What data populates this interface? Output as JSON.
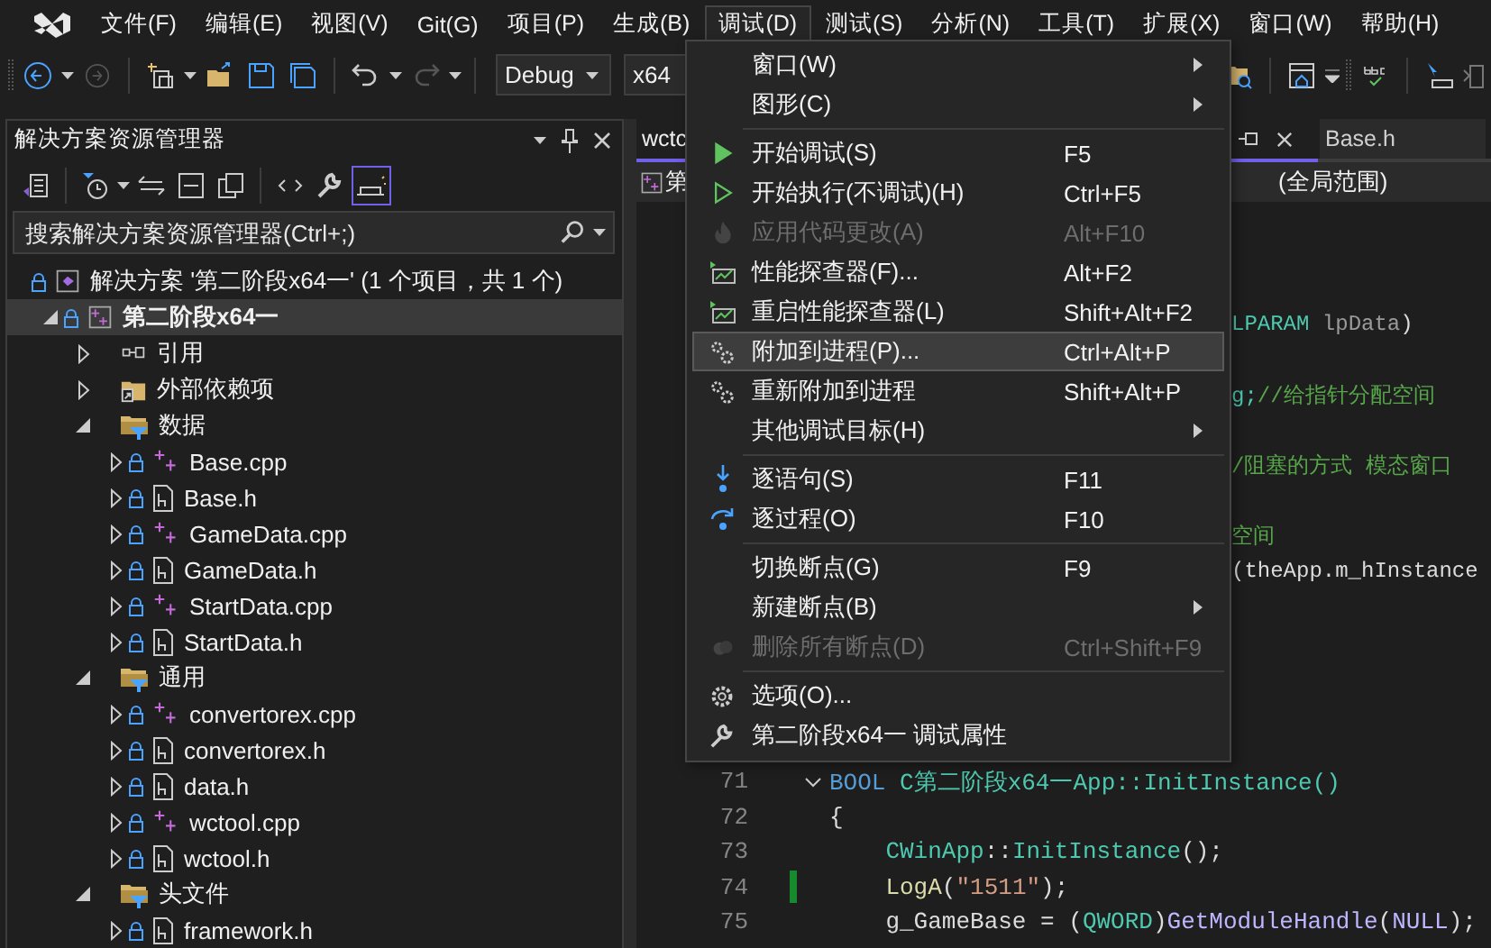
{
  "menu_bar": {
    "items": [
      {
        "label": "文件(F)",
        "selected": false
      },
      {
        "label": "编辑(E)",
        "selected": false
      },
      {
        "label": "视图(V)",
        "selected": false
      },
      {
        "label": "Git(G)",
        "selected": false
      },
      {
        "label": "项目(P)",
        "selected": false
      },
      {
        "label": "生成(B)",
        "selected": false
      },
      {
        "label": "调试(D)",
        "selected": true
      },
      {
        "label": "测试(S)",
        "selected": false
      },
      {
        "label": "分析(N)",
        "selected": false
      },
      {
        "label": "工具(T)",
        "selected": false
      },
      {
        "label": "扩展(X)",
        "selected": false
      },
      {
        "label": "窗口(W)",
        "selected": false
      },
      {
        "label": "帮助(H)",
        "selected": false
      }
    ]
  },
  "toolbar": {
    "configuration": "Debug",
    "platform": "x64"
  },
  "solution_explorer": {
    "title": "解决方案资源管理器",
    "toolbar_buttons": [
      {
        "kind": "switch-views",
        "selected": false
      },
      {
        "kind": "history",
        "selected": false
      },
      {
        "kind": "sync",
        "selected": false
      },
      {
        "kind": "collapse",
        "selected": false
      },
      {
        "kind": "copy",
        "selected": false
      },
      {
        "kind": "code",
        "selected": false
      },
      {
        "kind": "properties",
        "selected": false
      },
      {
        "kind": "preview",
        "selected": true
      }
    ],
    "search": {
      "placeholder": "搜索解决方案资源管理器(Ctrl+;)"
    },
    "tree": [
      {
        "label": "解决方案 '第二阶段x64一' (1 个项目，共 1 个)",
        "kind": "solution",
        "locked": true,
        "selected": false,
        "children": [
          {
            "label": "第二阶段x64一",
            "kind": "project",
            "locked": true,
            "expanded": true,
            "selected": true,
            "children": [
              {
                "label": "引用",
                "kind": "references",
                "locked": false,
                "expanded": false,
                "selected": false
              },
              {
                "label": "外部依赖项",
                "kind": "external",
                "locked": false,
                "expanded": false,
                "selected": false
              },
              {
                "label": "数据",
                "kind": "filter",
                "locked": false,
                "expanded": true,
                "selected": false,
                "children": [
                  {
                    "label": "Base.cpp",
                    "kind": "source",
                    "locked": true,
                    "expanded": false,
                    "selected": false
                  },
                  {
                    "label": "Base.h",
                    "kind": "header",
                    "locked": true,
                    "expanded": false,
                    "selected": false
                  },
                  {
                    "label": "GameData.cpp",
                    "kind": "source",
                    "locked": true,
                    "expanded": false,
                    "selected": false
                  },
                  {
                    "label": "GameData.h",
                    "kind": "header",
                    "locked": true,
                    "expanded": false,
                    "selected": false
                  },
                  {
                    "label": "StartData.cpp",
                    "kind": "source",
                    "locked": true,
                    "expanded": false,
                    "selected": false
                  },
                  {
                    "label": "StartData.h",
                    "kind": "header",
                    "locked": true,
                    "expanded": false,
                    "selected": false
                  }
                ]
              },
              {
                "label": "通用",
                "kind": "filter",
                "locked": false,
                "expanded": true,
                "selected": false,
                "children": [
                  {
                    "label": "convertorex.cpp",
                    "kind": "source",
                    "locked": true,
                    "expanded": false,
                    "selected": false
                  },
                  {
                    "label": "convertorex.h",
                    "kind": "header",
                    "locked": true,
                    "expanded": false,
                    "selected": false
                  },
                  {
                    "label": "data.h",
                    "kind": "header",
                    "locked": true,
                    "expanded": false,
                    "selected": false
                  },
                  {
                    "label": "wctool.cpp",
                    "kind": "source",
                    "locked": true,
                    "expanded": false,
                    "selected": false
                  },
                  {
                    "label": "wctool.h",
                    "kind": "header",
                    "locked": true,
                    "expanded": false,
                    "selected": false
                  }
                ]
              },
              {
                "label": "头文件",
                "kind": "filter",
                "locked": false,
                "expanded": true,
                "selected": false,
                "children": [
                  {
                    "label": "framework.h",
                    "kind": "header",
                    "locked": true,
                    "expanded": false,
                    "selected": false
                  }
                ]
              }
            ]
          }
        ]
      }
    ]
  },
  "editor": {
    "tabs": [
      {
        "label": "wctc",
        "selected": true
      },
      {
        "label": "Base.h",
        "selected": false
      }
    ],
    "nav": {
      "project": "第",
      "scope": "(全局范围)"
    },
    "fragments": [
      [
        {
          "text": "LPARAM",
          "kind": "type"
        },
        {
          "text": " lpData",
          "kind": "param"
        },
        {
          "text": ")",
          "kind": "plain"
        }
      ],
      [
        {
          "text": "g;",
          "kind": "type"
        },
        {
          "text": "//给指针分配空间",
          "kind": "comment"
        }
      ],
      [
        {
          "text": "/阻塞的方式 模态窗口",
          "kind": "comment"
        }
      ],
      [
        {
          "text": "空间",
          "kind": "comment"
        }
      ],
      [
        {
          "text": "(theApp.m_hInstance",
          "kind": "plain"
        }
      ]
    ],
    "lines": [
      {
        "number": "71",
        "foldable": true,
        "changed": false,
        "tokens": [
          {
            "text": "BOOL",
            "kind": "keyword"
          },
          {
            "text": " C第二阶段x64一App::InitInstance()",
            "kind": "type"
          }
        ]
      },
      {
        "number": "72",
        "foldable": false,
        "changed": false,
        "tokens": [
          {
            "text": "{",
            "kind": "plain"
          }
        ]
      },
      {
        "number": "73",
        "foldable": false,
        "changed": false,
        "tokens": [
          {
            "text": "    CWinApp",
            "kind": "type"
          },
          {
            "text": "::",
            "kind": "plain"
          },
          {
            "text": "InitInstance",
            "kind": "type"
          },
          {
            "text": "();",
            "kind": "plain"
          }
        ]
      },
      {
        "number": "74",
        "foldable": false,
        "changed": true,
        "tokens": [
          {
            "text": "    LogA",
            "kind": "func"
          },
          {
            "text": "(",
            "kind": "plain"
          },
          {
            "text": "\"1511\"",
            "kind": "string"
          },
          {
            "text": ");",
            "kind": "plain"
          }
        ]
      },
      {
        "number": "75",
        "foldable": false,
        "changed": false,
        "tokens": [
          {
            "text": "    g_GameBase = (",
            "kind": "plain"
          },
          {
            "text": "QWORD",
            "kind": "type"
          },
          {
            "text": ")",
            "kind": "plain"
          },
          {
            "text": "GetModuleHandle",
            "kind": "macro"
          },
          {
            "text": "(",
            "kind": "plain"
          },
          {
            "text": "NULL",
            "kind": "macro"
          },
          {
            "text": ");",
            "kind": "plain"
          }
        ]
      }
    ]
  },
  "debug_menu": {
    "items": [
      {
        "kind": "plain",
        "label": "窗口(W)",
        "submenu": true,
        "disabled": false,
        "selected": false
      },
      {
        "kind": "plain",
        "label": "图形(C)",
        "submenu": true,
        "disabled": false,
        "selected": false
      },
      {
        "kind": "separator"
      },
      {
        "kind": "run",
        "label": "开始调试(S)",
        "shortcut": "F5",
        "disabled": false,
        "selected": false
      },
      {
        "kind": "run-outline",
        "label": "开始执行(不调试)(H)",
        "shortcut": "Ctrl+F5",
        "disabled": false,
        "selected": false
      },
      {
        "kind": "hot-reload",
        "label": "应用代码更改(A)",
        "shortcut": "Alt+F10",
        "disabled": true,
        "selected": false
      },
      {
        "kind": "profiler",
        "label": "性能探查器(F)...",
        "shortcut": "Alt+F2",
        "disabled": false,
        "selected": false
      },
      {
        "kind": "profiler",
        "label": "重启性能探查器(L)",
        "shortcut": "Shift+Alt+F2",
        "disabled": false,
        "selected": false
      },
      {
        "kind": "attach",
        "label": "附加到进程(P)...",
        "shortcut": "Ctrl+Alt+P",
        "disabled": false,
        "selected": true
      },
      {
        "kind": "attach",
        "label": "重新附加到进程",
        "shortcut": "Shift+Alt+P",
        "disabled": false,
        "selected": false
      },
      {
        "kind": "plain",
        "label": "其他调试目标(H)",
        "submenu": true,
        "disabled": false,
        "selected": false
      },
      {
        "kind": "separator"
      },
      {
        "kind": "step-into",
        "label": "逐语句(S)",
        "shortcut": "F11",
        "disabled": false,
        "selected": false
      },
      {
        "kind": "step-over",
        "label": "逐过程(O)",
        "shortcut": "F10",
        "disabled": false,
        "selected": false
      },
      {
        "kind": "separator"
      },
      {
        "kind": "plain",
        "label": "切换断点(G)",
        "shortcut": "F9",
        "disabled": false,
        "selected": false
      },
      {
        "kind": "plain",
        "label": "新建断点(B)",
        "submenu": true,
        "disabled": false,
        "selected": false
      },
      {
        "kind": "delete-breakpoints",
        "label": "删除所有断点(D)",
        "shortcut": "Ctrl+Shift+F9",
        "disabled": true,
        "selected": false
      },
      {
        "kind": "separator"
      },
      {
        "kind": "options",
        "label": "选项(O)...",
        "disabled": false,
        "selected": false
      },
      {
        "kind": "properties",
        "label": "第二阶段x64一 调试属性",
        "disabled": false,
        "selected": false
      }
    ]
  }
}
